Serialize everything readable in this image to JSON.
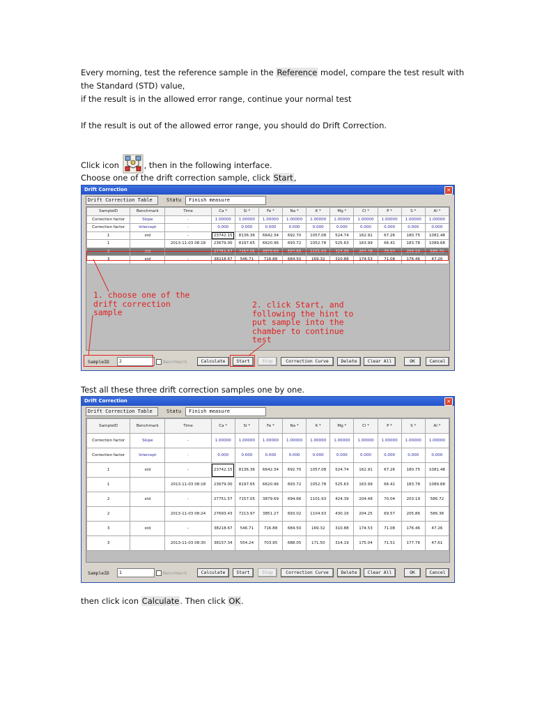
{
  "intro": {
    "line1_pre": "Every morning, test the reference sample in the ",
    "line1_hl": "Reference",
    "line1_post": " model, compare the test result with",
    "line2": "the Standard (STD) value,",
    "line3": "if the result is in the allowed error range, continue your normal test",
    "line4": "If the result is out of the allowed error range, you should do Drift Correction.",
    "click_pre": "Click icon ",
    "click_post": ", then in the following interface.",
    "choose_pre": "Choose one of the drift correction sample, click ",
    "choose_hl": "Start",
    "choose_post": ","
  },
  "window": {
    "title": "Drift Correction",
    "close": "✕",
    "tab_label": "Drift Correction Table",
    "status_label": "Statu",
    "status_value": "Finish measure",
    "columns": [
      "SampleID",
      "Benchmark",
      "Time",
      "Ca *",
      "Si *",
      "Fe *",
      "Na *",
      "K *",
      "Mg *",
      "Cl *",
      "P *",
      "S *",
      "Al *"
    ],
    "sample_id_label": "SampleID",
    "benchmark_label": "Benchmark",
    "buttons": {
      "calculate": "Calculate",
      "start": "Start",
      "stop": "Stop",
      "correction_curve": "Correction Curve",
      "delete": "Delete",
      "clear_all": "Clear All",
      "ok": "OK",
      "cancel": "Cancel"
    }
  },
  "table1": {
    "rows": [
      [
        "Correction factor",
        "Slope",
        "-",
        "1.00000",
        "1.00000",
        "1.00000",
        "1.00000",
        "1.00000",
        "1.00000",
        "1.00000",
        "1.00000",
        "1.00000",
        "1.00000"
      ],
      [
        "Correction factor",
        "Intercept",
        "-",
        "0.000",
        "0.000",
        "0.000",
        "0.000",
        "0.000",
        "0.000",
        "0.000",
        "0.000",
        "0.000",
        "0.000"
      ],
      [
        "1",
        "std",
        "-",
        "23742.15",
        "8136.36",
        "6642.34",
        "692.70",
        "1057.08",
        "524.74",
        "162.91",
        "67.26",
        "180.75",
        "1081.48"
      ],
      [
        "1",
        "",
        "2013-11-03 08:18",
        "23679.00",
        "8197.65",
        "6620.96",
        "693.72",
        "1052.78",
        "525.63",
        "163.99",
        "66.41",
        "183.78",
        "1089.68"
      ],
      [
        "2",
        "std",
        "-",
        "27751.57",
        "7157.05",
        "3879.69",
        "694.66",
        "1101.93",
        "424.39",
        "204.48",
        "70.04",
        "203.19",
        "586.72"
      ],
      [
        "3",
        "std",
        "-",
        "38218.67",
        "546.71",
        "716.88",
        "684.50",
        "169.32",
        "310.88",
        "174.53",
        "71.08",
        "176.46",
        "47.26"
      ]
    ]
  },
  "table2": {
    "rows": [
      [
        "Correction factor",
        "Slope",
        "-",
        "1.00000",
        "1.00000",
        "1.00000",
        "1.00000",
        "1.00000",
        "1.00000",
        "1.00000",
        "1.00000",
        "1.00000",
        "1.00000"
      ],
      [
        "Correction factor",
        "Intercept",
        "-",
        "0.000",
        "0.000",
        "0.000",
        "0.000",
        "0.000",
        "0.000",
        "0.000",
        "0.000",
        "0.000",
        "0.000"
      ],
      [
        "1",
        "std",
        "-",
        "23742.15",
        "8136.36",
        "6642.34",
        "692.70",
        "1057.08",
        "524.74",
        "162.91",
        "67.26",
        "180.75",
        "1081.48"
      ],
      [
        "1",
        "",
        "2013-11-03 08:18",
        "23679.00",
        "8197.65",
        "6620.96",
        "693.72",
        "1052.78",
        "525.63",
        "163.99",
        "66.41",
        "183.78",
        "1089.68"
      ],
      [
        "2",
        "std",
        "-",
        "27751.57",
        "7157.05",
        "3879.69",
        "694.66",
        "1101.93",
        "424.39",
        "204.48",
        "70.04",
        "203.19",
        "586.72"
      ],
      [
        "2",
        "",
        "2013-11-03 08:24",
        "27693.43",
        "7213.97",
        "3851.27",
        "693.02",
        "1104.93",
        "430.16",
        "204.25",
        "69.57",
        "205.86",
        "586.36"
      ],
      [
        "3",
        "std",
        "-",
        "38218.67",
        "546.71",
        "716.88",
        "684.50",
        "169.32",
        "310.88",
        "174.53",
        "71.08",
        "176.46",
        "47.26"
      ],
      [
        "3",
        "",
        "2013-11-03 08:30",
        "38157.34",
        "554.24",
        "703.95",
        "688.05",
        "171.50",
        "314.19",
        "175.04",
        "71.51",
        "177.76",
        "47.61"
      ]
    ]
  },
  "screen1": {
    "sample_id_value": "2",
    "annotation1": "1. choose one of the\ndrift correction\nsample",
    "annotation2": "2. click Start, and\nfollowing the hint to\nput sample into the\nchamber to continue\ntest"
  },
  "screen2": {
    "sample_id_value": "1"
  },
  "middle_text": "Test all these three drift correction samples one by one.",
  "outro": {
    "pre": "then click icon ",
    "hl1": "Calculate",
    "mid": ". Then click ",
    "hl2": "OK",
    "post": "."
  },
  "colors": {
    "annotation_red": "#e02020",
    "titlebar_blue": "#2452c9",
    "selected_row": "#7d7d7d"
  }
}
